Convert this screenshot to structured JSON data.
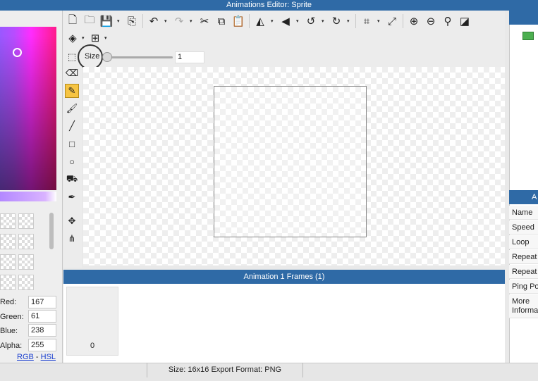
{
  "window": {
    "title": "Animations Editor: Sprite"
  },
  "toolbar": {
    "size_label": "Size",
    "size_value": "1"
  },
  "tools": [
    {
      "name": "marquee-select-icon",
      "glyph": "⬚"
    },
    {
      "name": "eraser-icon",
      "glyph": "⌫"
    },
    {
      "name": "pencil-icon",
      "glyph": "✎"
    },
    {
      "name": "brush-icon",
      "glyph": "🖌"
    },
    {
      "name": "line-icon",
      "glyph": "╱"
    },
    {
      "name": "rectangle-icon",
      "glyph": "□"
    },
    {
      "name": "ellipse-icon",
      "glyph": "○"
    },
    {
      "name": "paint-bucket-icon",
      "glyph": "⛟"
    },
    {
      "name": "eyedropper-icon",
      "glyph": "✒"
    },
    {
      "name": "move-icon",
      "glyph": "✥"
    },
    {
      "name": "transform-icon",
      "glyph": "⋔"
    }
  ],
  "color": {
    "hex": "#a73dee",
    "red_label": "Red:",
    "red": "167",
    "green_label": "Green:",
    "green": "61",
    "blue_label": "Blue:",
    "blue": "238",
    "alpha_label": "Alpha:",
    "alpha": "255",
    "rgb_link": "RGB",
    "link_sep": "-",
    "hsl_link": "HSL"
  },
  "frames": {
    "header": "Animation 1 Frames (1)",
    "items": [
      {
        "index": "0"
      }
    ]
  },
  "properties": {
    "header": "A",
    "rows": [
      "Name",
      "Speed",
      "Loop",
      "Repeat",
      "Repeat",
      "Ping Po",
      "More Informa"
    ]
  },
  "status": {
    "text": "Size: 16x16   Export Format: PNG"
  }
}
